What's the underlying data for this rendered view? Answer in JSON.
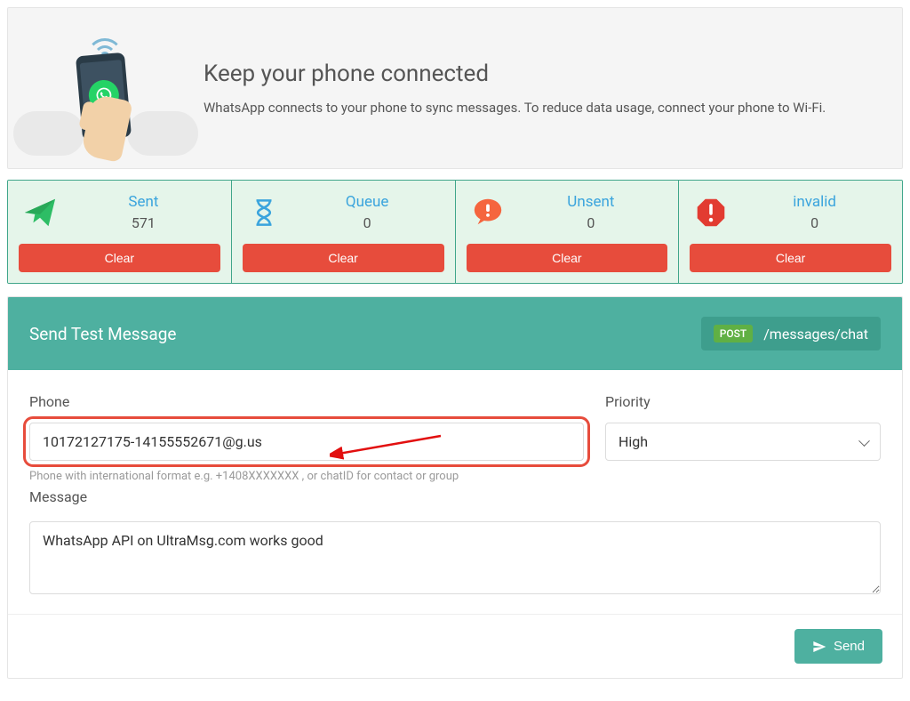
{
  "banner": {
    "title": "Keep your phone connected",
    "subtitle": "WhatsApp connects to your phone to sync messages. To reduce data usage, connect your phone to Wi-Fi."
  },
  "stats": [
    {
      "icon": "paper-plane",
      "title": "Sent",
      "value": "571",
      "clear": "Clear",
      "color": "#2dbd65"
    },
    {
      "icon": "hourglass",
      "title": "Queue",
      "value": "0",
      "clear": "Clear",
      "color": "#3aa4dd"
    },
    {
      "icon": "alert-bubble",
      "title": "Unsent",
      "value": "0",
      "clear": "Clear",
      "color": "#f5653e"
    },
    {
      "icon": "stop",
      "title": "invalid",
      "value": "0",
      "clear": "Clear",
      "color": "#e23b31"
    }
  ],
  "panel": {
    "title": "Send Test Message",
    "method_badge": "POST",
    "endpoint": "/messages/chat"
  },
  "form": {
    "phone_label": "Phone",
    "phone_value": "10172127175-14155552671@g.us",
    "phone_help": "Phone with international format e.g. +1408XXXXXXX , or chatID for contact or group",
    "priority_label": "Priority",
    "priority_value": "High",
    "message_label": "Message",
    "message_value": "WhatsApp API on UltraMsg.com works good",
    "send_label": "Send"
  }
}
